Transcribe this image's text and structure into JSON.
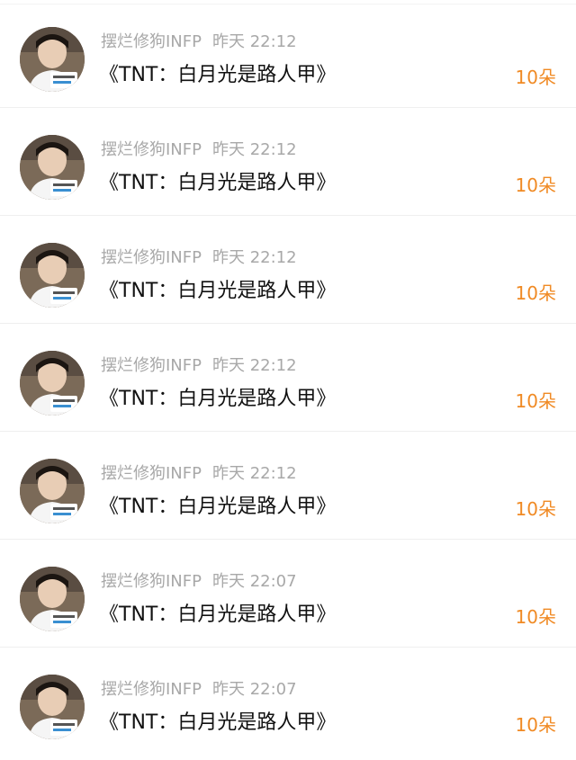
{
  "items": [
    {
      "author": "摆烂修狗INFP",
      "time": "昨天 22:12",
      "title": "《TNT：白月光是路人甲》",
      "count": "10朵"
    },
    {
      "author": "摆烂修狗INFP",
      "time": "昨天 22:12",
      "title": "《TNT：白月光是路人甲》",
      "count": "10朵"
    },
    {
      "author": "摆烂修狗INFP",
      "time": "昨天 22:12",
      "title": "《TNT：白月光是路人甲》",
      "count": "10朵"
    },
    {
      "author": "摆烂修狗INFP",
      "time": "昨天 22:12",
      "title": "《TNT：白月光是路人甲》",
      "count": "10朵"
    },
    {
      "author": "摆烂修狗INFP",
      "time": "昨天 22:12",
      "title": "《TNT：白月光是路人甲》",
      "count": "10朵"
    },
    {
      "author": "摆烂修狗INFP",
      "time": "昨天 22:07",
      "title": "《TNT：白月光是路人甲》",
      "count": "10朵"
    },
    {
      "author": "摆烂修狗INFP",
      "time": "昨天 22:07",
      "title": "《TNT：白月光是路人甲》",
      "count": "10朵"
    }
  ],
  "colors": {
    "meta_text": "#a8a8a8",
    "title_text": "#111111",
    "count_accent": "#f08a24",
    "divider": "#efefef"
  },
  "icons": {
    "avatar": "user-avatar-photo"
  }
}
